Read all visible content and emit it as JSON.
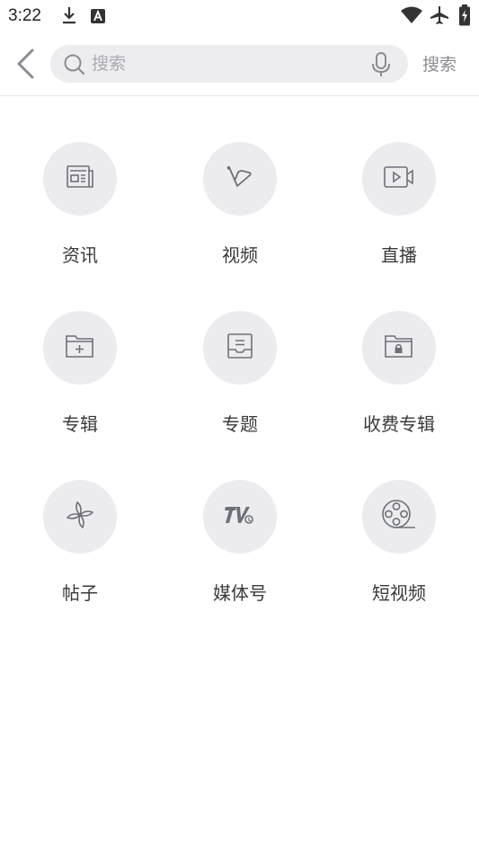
{
  "status_bar": {
    "time": "3:22",
    "left_icons": [
      "download-icon",
      "font-a-icon"
    ],
    "right_icons": [
      "wifi-icon",
      "airplane-icon",
      "battery-charging-icon"
    ]
  },
  "header": {
    "back_icon": "back-arrow-icon",
    "search": {
      "placeholder": "搜索",
      "value": "",
      "search_icon": "search-icon",
      "mic_icon": "microphone-icon"
    },
    "submit_label": "搜索"
  },
  "categories": [
    {
      "label": "资讯",
      "icon": "news-icon"
    },
    {
      "label": "视频",
      "icon": "video-icon"
    },
    {
      "label": "直播",
      "icon": "live-camera-icon"
    },
    {
      "label": "专辑",
      "icon": "album-folder-icon"
    },
    {
      "label": "专题",
      "icon": "topic-icon"
    },
    {
      "label": "收费专辑",
      "icon": "paid-album-icon"
    },
    {
      "label": "帖子",
      "icon": "post-pinwheel-icon"
    },
    {
      "label": "媒体号",
      "icon": "media-tv-icon"
    },
    {
      "label": "短视频",
      "icon": "short-video-reel-icon"
    }
  ],
  "colors": {
    "circle_bg": "#ececef",
    "icon_stroke": "#6e7078",
    "search_bg": "#ededf0",
    "placeholder": "#a9abb1"
  }
}
